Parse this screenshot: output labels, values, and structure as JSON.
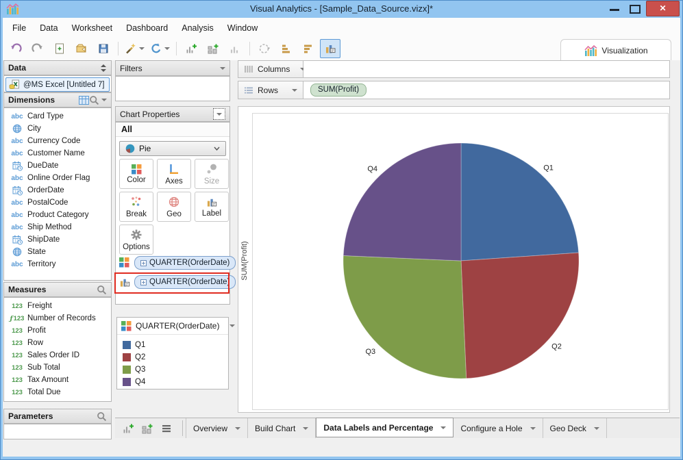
{
  "window": {
    "title": "Visual Analytics - [Sample_Data_Source.vizx]*"
  },
  "menu_bar": {
    "items": [
      "File",
      "Data",
      "Worksheet",
      "Dashboard",
      "Analysis",
      "Window"
    ]
  },
  "toolbar": {
    "buttons": [
      {
        "icon": "undo-icon"
      },
      {
        "icon": "redo-icon"
      },
      {
        "icon": "new-document-icon"
      },
      {
        "icon": "open-folder-icon"
      },
      {
        "icon": "save-icon"
      },
      {
        "type": "separator"
      },
      {
        "icon": "connect-wand-icon",
        "dropdown": true
      },
      {
        "icon": "refresh-icon",
        "dropdown": true
      },
      {
        "type": "separator"
      },
      {
        "icon": "add-worksheet-icon"
      },
      {
        "icon": "add-dashboard-icon"
      },
      {
        "icon": "chart-bars-icon",
        "disabled": true
      },
      {
        "type": "separator"
      },
      {
        "icon": "marquee-icon",
        "disabled": true
      },
      {
        "icon": "sort-ascending-icon"
      },
      {
        "icon": "sort-descending-icon"
      },
      {
        "icon": "show-labels-icon",
        "active": true
      }
    ],
    "visualization_label": "Visualization"
  },
  "sidebar": {
    "data_header": "Data",
    "data_source": {
      "label": "@MS Excel [Untitled 7]",
      "icon": "excel-icon"
    },
    "dimensions": {
      "header": "Dimensions",
      "items": [
        {
          "label": "Card Type",
          "icon": "text"
        },
        {
          "label": "City",
          "icon": "geo"
        },
        {
          "label": "Currency Code",
          "icon": "text"
        },
        {
          "label": "Customer Name",
          "icon": "text"
        },
        {
          "label": "DueDate",
          "icon": "date"
        },
        {
          "label": "Online Order Flag",
          "icon": "text"
        },
        {
          "label": "OrderDate",
          "icon": "date"
        },
        {
          "label": "PostalCode",
          "icon": "text"
        },
        {
          "label": "Product Category",
          "icon": "text"
        },
        {
          "label": "Ship Method",
          "icon": "text"
        },
        {
          "label": "ShipDate",
          "icon": "date"
        },
        {
          "label": "State",
          "icon": "geo"
        },
        {
          "label": "Territory",
          "icon": "text"
        }
      ]
    },
    "measures": {
      "header": "Measures",
      "items": [
        {
          "label": "Freight",
          "icon": "number"
        },
        {
          "label": "Number of Records",
          "icon": "calculated-number"
        },
        {
          "label": "Profit",
          "icon": "number"
        },
        {
          "label": "Row",
          "icon": "number"
        },
        {
          "label": "Sales Order ID",
          "icon": "number"
        },
        {
          "label": "Sub Total",
          "icon": "number"
        },
        {
          "label": "Tax Amount",
          "icon": "number"
        },
        {
          "label": "Total Due",
          "icon": "number"
        }
      ]
    },
    "parameters": {
      "header": "Parameters"
    }
  },
  "properties": {
    "filters_header": "Filters",
    "chart_properties_header": "Chart Properties",
    "scope_label": "All",
    "chart_type_selector": {
      "value": "Pie",
      "icon": "pie-chart-icon"
    },
    "buttons": [
      {
        "label": "Color",
        "icon": "color-squares-icon"
      },
      {
        "label": "Axes",
        "icon": "axes-icon"
      },
      {
        "label": "Size",
        "icon": "size-circles-icon",
        "disabled": true
      },
      {
        "label": "Break",
        "icon": "break-scatter-icon"
      },
      {
        "label": "Geo",
        "icon": "geo-globe-icon"
      },
      {
        "label": "Label",
        "icon": "label-bars-icon"
      },
      {
        "label": "Options",
        "icon": "gear-icon"
      }
    ],
    "shelves": [
      {
        "icon": "color-squares-icon",
        "chip": "QUARTER(OrderDate)",
        "highlighted": false
      },
      {
        "icon": "label-bars-icon",
        "chip": "QUARTER(OrderDate)",
        "highlighted": true
      }
    ],
    "legend": {
      "icon": "color-squares-icon",
      "title": "QUARTER(OrderDate)",
      "items": [
        {
          "label": "Q1",
          "color": "#41699e"
        },
        {
          "label": "Q2",
          "color": "#9e4243"
        },
        {
          "label": "Q3",
          "color": "#7e9c49"
        },
        {
          "label": "Q4",
          "color": "#675189"
        }
      ]
    }
  },
  "shelf_bar": {
    "columns_label": "Columns",
    "rows_label": "Rows",
    "rows_pills": [
      "SUM(Profit)"
    ]
  },
  "chart_data": {
    "type": "pie",
    "title": "",
    "ylabel": "SUM(Profit)",
    "categories": [
      "Q1",
      "Q2",
      "Q3",
      "Q4"
    ],
    "values": [
      23.9,
      25.4,
      26.4,
      24.3
    ],
    "value_unit": "percent_of_total_estimated",
    "colors": [
      "#41699e",
      "#9e4243",
      "#7e9c49",
      "#675189"
    ],
    "start_angle_deg": 0,
    "direction": "clockwise",
    "label_position": "outside",
    "legend_position": "left-panel"
  },
  "bottom_bar": {
    "icons": [
      "add-worksheet-icon",
      "add-dashboard-icon",
      "worksheet-list-icon"
    ],
    "tabs": [
      {
        "label": "Overview",
        "active": false
      },
      {
        "label": "Build Chart",
        "active": false
      },
      {
        "label": "Data Labels and Percentage",
        "active": true
      },
      {
        "label": "Configure a Hole",
        "active": false
      },
      {
        "label": "Geo Deck",
        "active": false
      }
    ]
  }
}
